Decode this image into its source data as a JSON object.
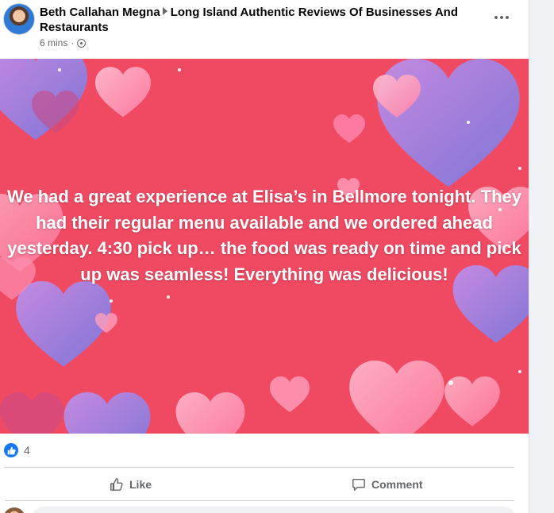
{
  "post": {
    "author": "Beth Callahan Megna",
    "group": "Long Island Authentic Reviews Of Businesses And Restaurants",
    "time": "6 mins",
    "privacy_icon": "group-members-icon",
    "more_icon": "more-options-icon",
    "body_text": "We had a great experience at Elisa’s in Bellmore tonight. They had their regular menu available and we ordered ahead yesterday. 4:30 pick up… the food was ready on time and pick up was seamless! Everything was delicious!",
    "background_colors": {
      "base": "#f04a63",
      "heart_purple": "#9b7fd6",
      "heart_pink": "#ff8fb0",
      "heart_light": "#ffb8cc"
    }
  },
  "reactions": {
    "icon": "like-icon",
    "count": "4",
    "color": "#1877f2"
  },
  "actions": {
    "like_label": "Like",
    "comment_label": "Comment"
  }
}
